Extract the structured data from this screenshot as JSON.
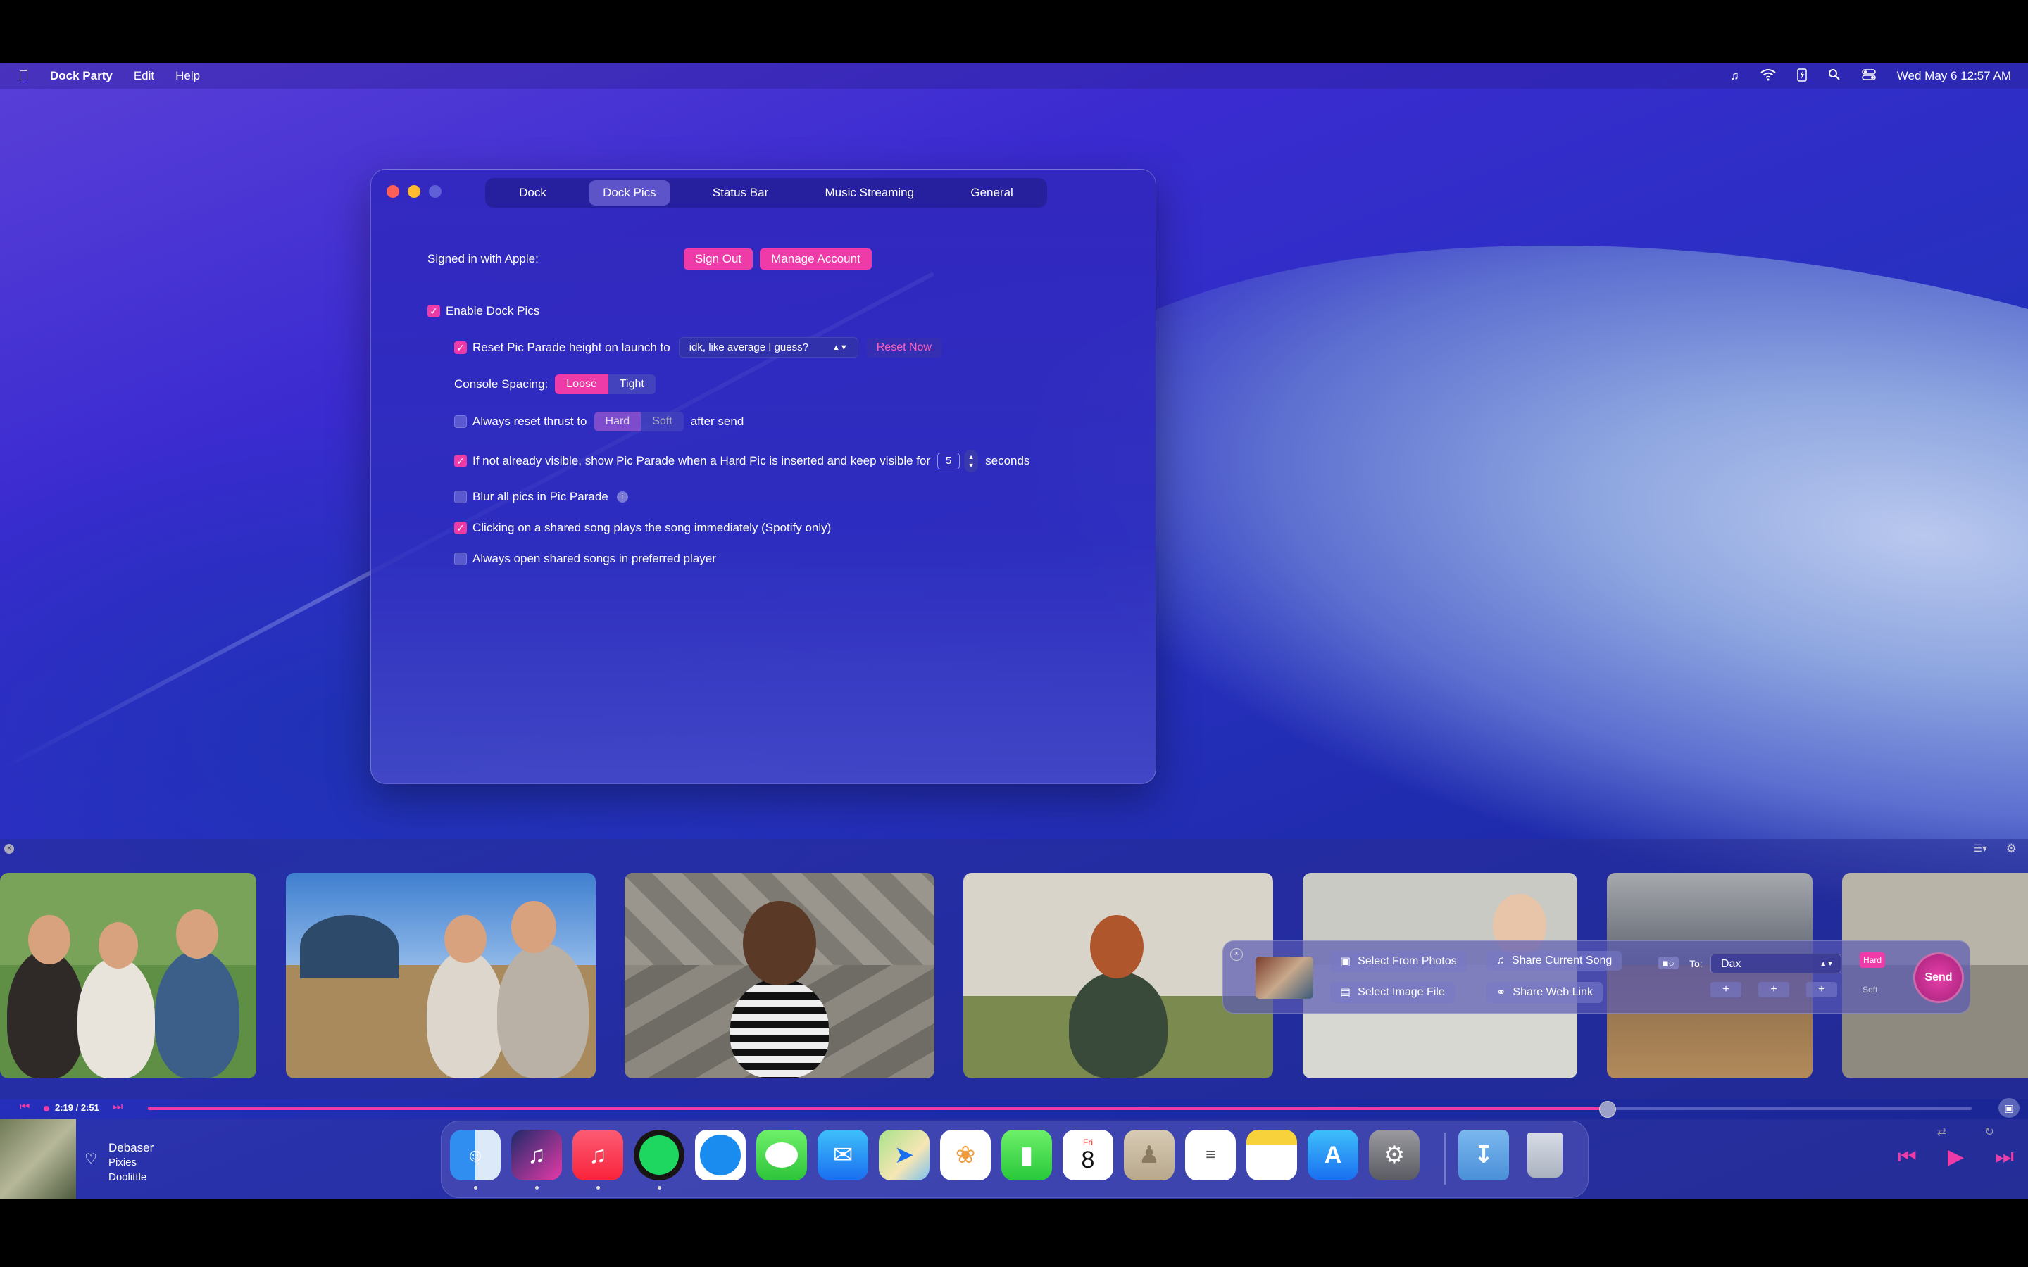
{
  "menubar": {
    "app_name": "Dock Party",
    "menus": [
      "Edit",
      "Help"
    ],
    "clock": "Wed May 6  12:57 AM"
  },
  "window": {
    "tabs": [
      "Dock",
      "Dock Pics",
      "Status Bar",
      "Music Streaming",
      "General"
    ],
    "active_tab": "Dock Pics",
    "signed_in_label": "Signed in with Apple:",
    "sign_out": "Sign Out",
    "manage_account": "Manage Account",
    "enable_dock_pics": "Enable Dock Pics",
    "reset_height_label": "Reset Pic Parade height on launch to",
    "reset_height_value": "idk, like average I guess?",
    "reset_now": "Reset Now",
    "console_spacing_label": "Console Spacing:",
    "spacing_options": [
      "Loose",
      "Tight"
    ],
    "spacing_selected": "Loose",
    "reset_thrust_label": "Always reset thrust to",
    "thrust_options": [
      "Hard",
      "Soft"
    ],
    "after_send": "after send",
    "show_parade_label": "If not already visible, show Pic Parade when a Hard Pic is inserted and keep visible for",
    "seconds_value": "5",
    "seconds_label": "seconds",
    "blur_label": "Blur all pics in Pic Parade",
    "clicking_label": "Clicking on a shared song plays the song immediately (Spotify only)",
    "always_open_label": "Always open shared songs in preferred player",
    "checks": {
      "enable": true,
      "reset_height": true,
      "reset_thrust": false,
      "show_parade": true,
      "blur": false,
      "clicking": true,
      "always_open": false
    }
  },
  "share_panel": {
    "select_photos": "Select From Photos",
    "share_song": "Share Current Song",
    "select_image": "Select Image File",
    "share_web": "Share Web Link",
    "to_label": "To:",
    "to_value": "Dax",
    "hard": "Hard",
    "soft": "Soft",
    "send": "Send"
  },
  "player": {
    "time": "2:19 / 2:51",
    "progress": 0.8,
    "title": "Debaser",
    "artist": "Pixies",
    "album": "Doolittle"
  },
  "dock": {
    "calendar_day": "Fri",
    "calendar_date": "8"
  },
  "colors": {
    "accent": "#ee3ba8",
    "window_bg": "#2f2dbe"
  }
}
